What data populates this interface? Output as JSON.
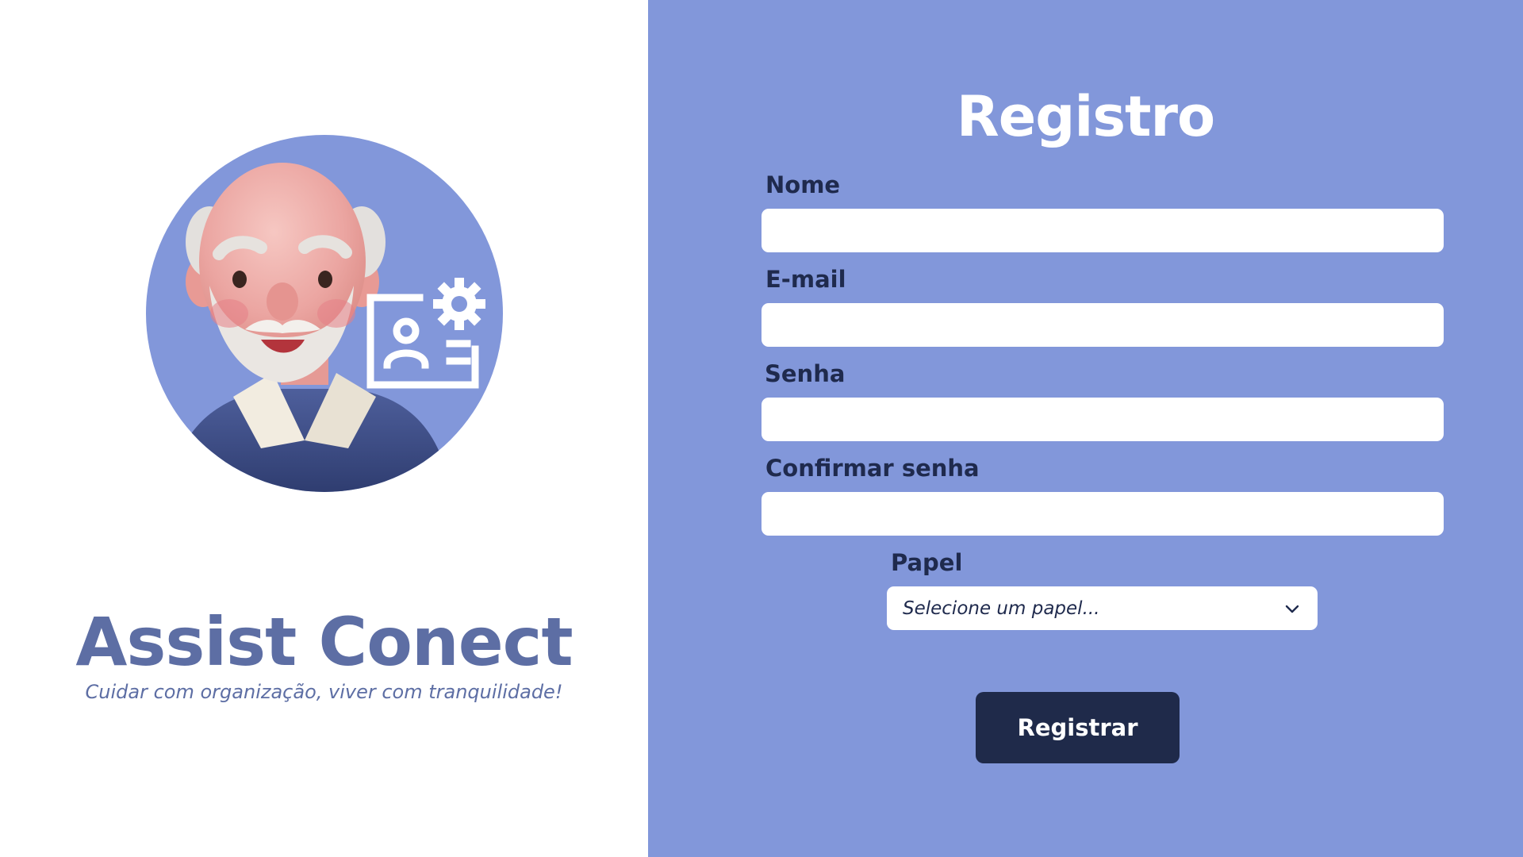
{
  "brand": {
    "name": "Assist Conect",
    "tagline": "Cuidar com organização, viver com tranquilidade!"
  },
  "form": {
    "title": "Registro",
    "fields": {
      "nome": {
        "label": "Nome",
        "value": "",
        "placeholder": ""
      },
      "email": {
        "label": "E-mail",
        "value": "",
        "placeholder": ""
      },
      "senha": {
        "label": "Senha",
        "value": "",
        "placeholder": ""
      },
      "confirmar": {
        "label": "Confirmar senha",
        "value": "",
        "placeholder": ""
      }
    },
    "role": {
      "label": "Papel",
      "selected": "Selecione um papel..."
    },
    "submit_label": "Registrar"
  },
  "icons": {
    "avatar": "elderly-man-avatar-icon",
    "profile_card": "profile-settings-icon",
    "dropdown": "chevron-down-icon"
  },
  "colors": {
    "panel_bg": "#8297da",
    "brand_text": "#5d6ea4",
    "label_text": "#1f2a4d",
    "button_bg": "#1f2a4a",
    "title_text": "#ffffff"
  }
}
